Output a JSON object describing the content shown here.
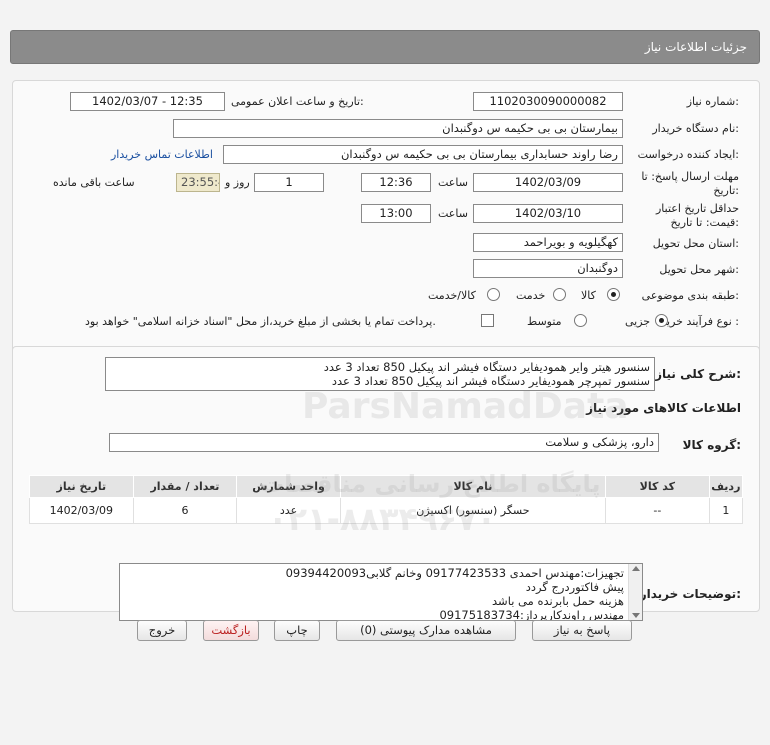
{
  "header": {
    "title": "جزئیات اطلاعات نیاز"
  },
  "info": {
    "need_number_label": "شماره نیاز:",
    "need_number": "1102030090000082",
    "announce_label": "تاریخ و ساعت اعلان عمومی:",
    "announce_value": "1402/03/07 - 12:35",
    "buyer_org_label": "نام دستگاه خریدار:",
    "buyer_org": "بیمارستان بی بی حکیمه س  دوگنبدان",
    "creator_label": "ایجاد کننده درخواست:",
    "creator": "رضا راوند حسابداری بیمارستان بی بی حکیمه س  دوگنبدان",
    "contact_link": "اطلاعات تماس خریدار",
    "deadline_label_1": "مهلت ارسال پاسخ: تا",
    "deadline_label_2": "تاریخ:",
    "deadline_date": "1402/03/09",
    "time_label": "ساعت",
    "deadline_time": "12:36",
    "days_value": "1",
    "days_label": "روز و",
    "remaining_time": "23:55:46",
    "remaining_label": "ساعت باقی مانده",
    "validity_label_1": "حداقل تاریخ اعتبار",
    "validity_label_2": "قیمت: تا تاریخ:",
    "validity_date": "1402/03/10",
    "validity_time_label": "ساعت",
    "validity_time": "13:00",
    "province_label": "استان محل تحویل:",
    "province": "کهگیلویه و بویراحمد",
    "city_label": "شهر محل تحویل:",
    "city": "دوگنبدان",
    "category_label": "طبقه بندی موضوعی:",
    "category_options": [
      "کالا",
      "خدمت",
      "کالا/خدمت"
    ],
    "process_label": "نوع فرآیند خرید :",
    "process_options": [
      "جزیی",
      "متوسط"
    ],
    "payment_note": "پرداخت تمام یا بخشی از مبلغ خرید،از محل \"اسناد خزانه اسلامی\" خواهد بود."
  },
  "summary": {
    "label": "شرح کلی نیاز:",
    "line1": "سنسور هیتر وایر همودیفایر دستگاه فیشر اند پیکیل 850 تعداد 3 عدد",
    "line2": "سنسور تمپرچر همودیفایر  دستگاه فیشر اند پیکیل 850 تعداد 3 عدد"
  },
  "goods": {
    "section_title": "اطلاعات کالاهای مورد نیاز",
    "group_label": "گروه کالا:",
    "group_value": "دارو، پزشکی و سلامت",
    "columns": [
      "ردیف",
      "کد کالا",
      "نام کالا",
      "واحد شمارش",
      "تعداد / مقدار",
      "تاریخ نیاز"
    ],
    "rows": [
      {
        "row": "1",
        "code": "--",
        "name": "حسگر (سنسور) اکسیژن",
        "unit": "عدد",
        "qty": "6",
        "date": "1402/03/09"
      }
    ]
  },
  "buyer_notes": {
    "label": "توضیحات خریدار:",
    "lines": [
      "تجهیزات:مهندس احمدی 09177423533 وخانم گلابی09394420093",
      "پیش فاکتوردرج گردد",
      "هزینه حمل بابرنده می باشد",
      "مهندس راوندکارپرداز:09175183734"
    ]
  },
  "buttons": {
    "reply": "پاسخ به نیاز",
    "attachments": "مشاهده مدارک پیوستی (0)",
    "print": "چاپ",
    "back": "بازگشت",
    "exit": "خروج"
  },
  "watermark": {
    "brand": "ParsNamadData",
    "line1": "پایگاه اطلاع رسانی مناقصات",
    "phone": "۰۲۱-۸۸۳۴۹۶۷۰"
  }
}
